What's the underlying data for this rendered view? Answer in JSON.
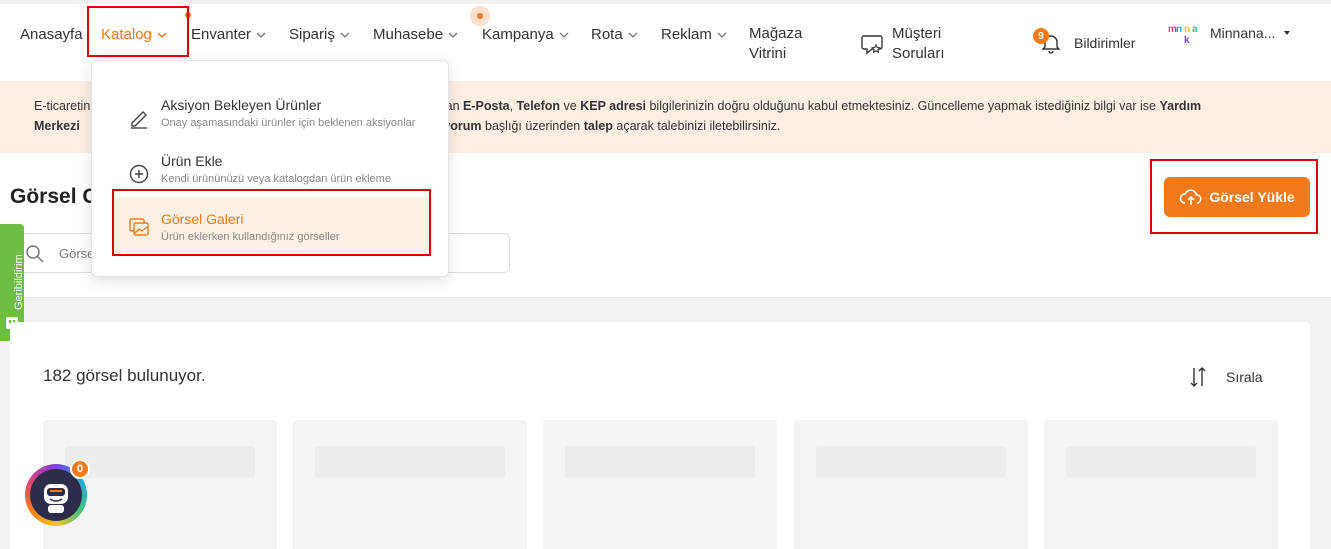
{
  "nav": {
    "items": [
      {
        "label": "Anasayfa"
      },
      {
        "label": "Katalog"
      },
      {
        "label": "Envanter"
      },
      {
        "label": "Sipariş"
      },
      {
        "label": "Muhasebe"
      },
      {
        "label": "Kampanya"
      },
      {
        "label": "Rota"
      },
      {
        "label": "Reklam"
      },
      {
        "label_line1": "Mağaza",
        "label_line2": "Vitrini"
      },
      {
        "label_line1": "Müşteri",
        "label_line2": "Soruları"
      }
    ],
    "notifications_label": "Bildirimler",
    "notifications_count": "9",
    "user_name": "Minnana...",
    "accent_color": "#f27a1a"
  },
  "banner": {
    "line1_a": "E-ticaretin",
    "line1_b": "r alan ",
    "line1_email": "E-Posta",
    "line1_sep1": ", ",
    "line1_phone": "Telefon",
    "line1_ve": " ve ",
    "line1_kep": "KEP adresi",
    "line1_c": " bilgilerinizin doğru olduğunu kabul etmektesiniz. Güncelleme yapmak istediğiniz bilgi var ise ",
    "line1_help": "Yardım",
    "line2_a": "Merkezi ",
    "line2_yorum": "yorum",
    "line2_b": " başlığı üzerinden ",
    "line2_talep": "talep",
    "line2_c": " açarak talebinizi iletebilirsiniz."
  },
  "page": {
    "title": "Görsel G",
    "search_placeholder": "Görse",
    "upload_button": "Görsel Yükle",
    "feedback_tab": "Geribildirim"
  },
  "gallery": {
    "count_text": "182 görsel bulunuyor.",
    "sort_label": "Sırala",
    "tiles": 5
  },
  "bot": {
    "badge": "0"
  },
  "dropdown": {
    "items": [
      {
        "title": "Aksiyon Bekleyen Ürünler",
        "subtitle": "Onay aşamasındaki ürünler için beklenen aksiyonlar",
        "icon": "pencil-icon"
      },
      {
        "title": "Ürün Ekle",
        "subtitle": "Kendi ürününüzü veya katalogdan ürün ekleme",
        "icon": "plus-circle-icon"
      },
      {
        "title": "Görsel Galeri",
        "subtitle": "Ürün eklerken kullandığınız görseller",
        "icon": "gallery-icon",
        "selected": true
      }
    ]
  }
}
